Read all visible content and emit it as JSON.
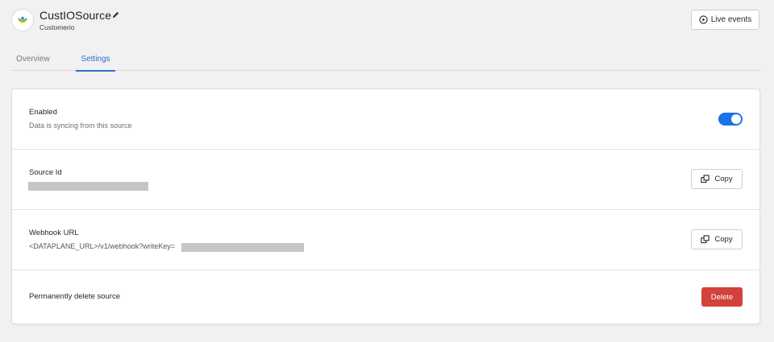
{
  "header": {
    "title": "CustIOSource",
    "subtitle": "Customerio",
    "live_events_label": "Live events",
    "icons": {
      "logo": "customerio-logo-icon",
      "edit": "pencil-icon",
      "live": "play-circle-icon"
    }
  },
  "tabs": [
    {
      "label": "Overview",
      "active": false
    },
    {
      "label": "Settings",
      "active": true
    }
  ],
  "settings": {
    "enabled": {
      "label": "Enabled",
      "description": "Data is syncing from this source",
      "toggle_on": true
    },
    "source_id": {
      "label": "Source Id",
      "copy_label": "Copy"
    },
    "webhook": {
      "label": "Webhook URL",
      "url_prefix": "<DATAPLANE_URL>/v1/webhook?writeKey=",
      "copy_label": "Copy"
    },
    "delete": {
      "label": "Permanently delete source",
      "button_label": "Delete"
    }
  },
  "colors": {
    "accent": "#2f6fc9",
    "toggle": "#1a73e8",
    "danger": "#d0423a",
    "redacted": "#c6c6c6"
  }
}
